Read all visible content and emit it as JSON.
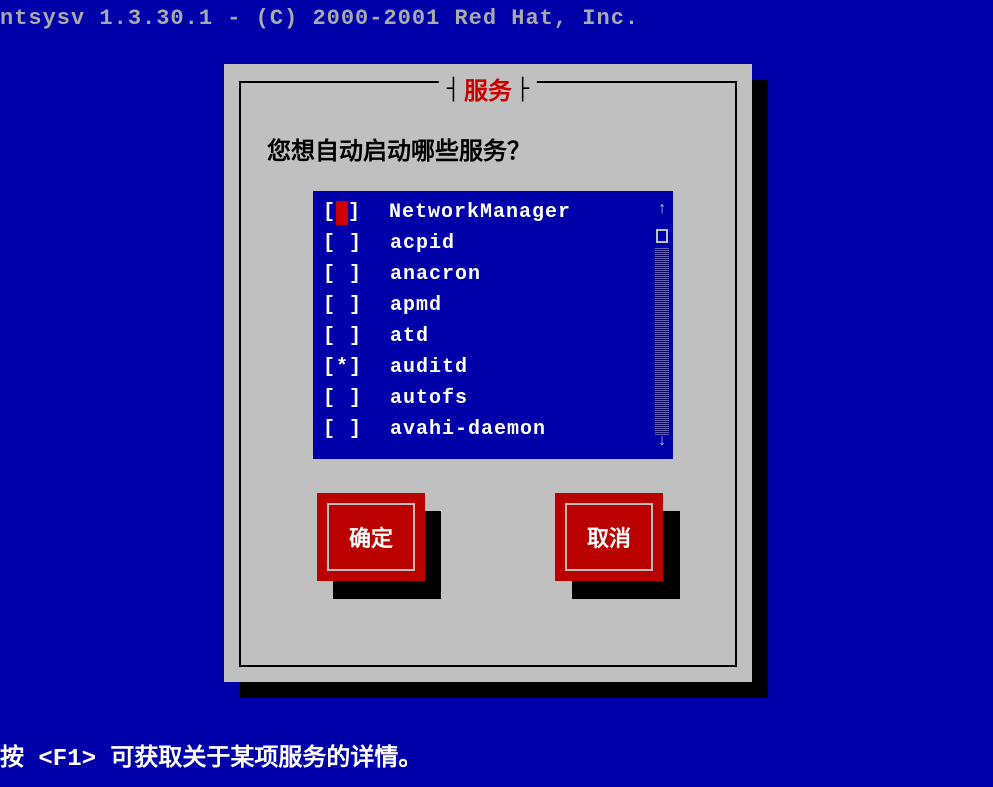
{
  "header": "ntsysv 1.3.30.1 - (C) 2000-2001 Red Hat, Inc.",
  "dialog": {
    "title": "服务",
    "prompt": "您想自动启动哪些服务？",
    "services": [
      {
        "name": "NetworkManager",
        "checked": false,
        "cursor": true
      },
      {
        "name": "acpid",
        "checked": false,
        "cursor": false
      },
      {
        "name": "anacron",
        "checked": false,
        "cursor": false
      },
      {
        "name": "apmd",
        "checked": false,
        "cursor": false
      },
      {
        "name": "atd",
        "checked": false,
        "cursor": false
      },
      {
        "name": "auditd",
        "checked": true,
        "cursor": false
      },
      {
        "name": "autofs",
        "checked": false,
        "cursor": false
      },
      {
        "name": "avahi-daemon",
        "checked": false,
        "cursor": false
      }
    ],
    "buttons": {
      "ok": "确定",
      "cancel": "取消"
    },
    "scroll": {
      "up": "↑",
      "down": "↓"
    }
  },
  "footer": {
    "prefix": "按 ",
    "key": "<F1>",
    "suffix": " 可获取关于某项服务的详情。"
  },
  "title_bars": "┤",
  "title_bars_end": "├"
}
